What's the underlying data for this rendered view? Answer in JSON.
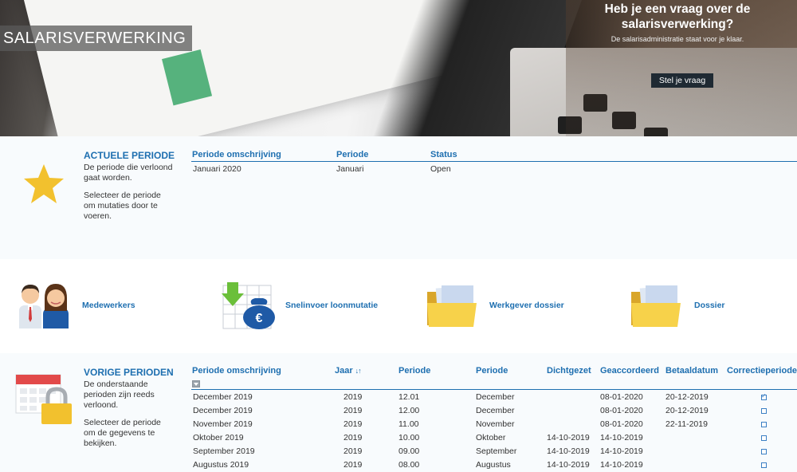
{
  "hero": {
    "title": "SALARISVERWERKING",
    "question": "Heb je een vraag over de salarisverwerking?",
    "subtext": "De salarisadministratie staat voor je klaar.",
    "button_label": "Stel je vraag"
  },
  "current": {
    "title": "ACTUELE PERIODE",
    "desc1": "De periode die verloond gaat worden.",
    "desc2": "Selecteer de periode om mutaties door te voeren.",
    "columns": [
      "Periode omschrijving",
      "Periode",
      "Status"
    ],
    "row": {
      "omschrijving": "Januari 2020",
      "periode": "Januari",
      "status": "Open"
    }
  },
  "tiles": [
    {
      "label": "Medewerkers",
      "icon": "employees-icon"
    },
    {
      "label": "Snelinvoer loonmutatie",
      "icon": "quick-entry-icon"
    },
    {
      "label": "Werkgever dossier",
      "icon": "folder-icon"
    },
    {
      "label": "Dossier",
      "icon": "folder-icon"
    }
  ],
  "previous": {
    "title": "VORIGE PERIODEN",
    "desc1": "De onderstaande perioden zijn reeds verloond.",
    "desc2": "Selecteer de periode om de gegevens te bekijken.",
    "columns": [
      "Periode omschrijving",
      "Jaar",
      "Periode",
      "Periode",
      "Dichtgezet",
      "Geaccordeerd",
      "Betaaldatum",
      "Correctieperiode"
    ],
    "sort_glyph": "↓↑",
    "rows": [
      {
        "omschrijving": "December 2019",
        "jaar": "2019",
        "nr": "12.01",
        "periode": "December",
        "dichtgezet": "",
        "geaccordeerd": "08-01-2020",
        "betaaldatum": "20-12-2019",
        "correctie": true
      },
      {
        "omschrijving": "December 2019",
        "jaar": "2019",
        "nr": "12.00",
        "periode": "December",
        "dichtgezet": "",
        "geaccordeerd": "08-01-2020",
        "betaaldatum": "20-12-2019",
        "correctie": false
      },
      {
        "omschrijving": "November 2019",
        "jaar": "2019",
        "nr": "11.00",
        "periode": "November",
        "dichtgezet": "",
        "geaccordeerd": "08-01-2020",
        "betaaldatum": "22-11-2019",
        "correctie": false
      },
      {
        "omschrijving": "Oktober 2019",
        "jaar": "2019",
        "nr": "10.00",
        "periode": "Oktober",
        "dichtgezet": "14-10-2019",
        "geaccordeerd": "14-10-2019",
        "betaaldatum": "",
        "correctie": false
      },
      {
        "omschrijving": "September 2019",
        "jaar": "2019",
        "nr": "09.00",
        "periode": "September",
        "dichtgezet": "14-10-2019",
        "geaccordeerd": "14-10-2019",
        "betaaldatum": "",
        "correctie": false
      },
      {
        "omschrijving": "Augustus 2019",
        "jaar": "2019",
        "nr": "08.00",
        "periode": "Augustus",
        "dichtgezet": "14-10-2019",
        "geaccordeerd": "14-10-2019",
        "betaaldatum": "",
        "correctie": false
      }
    ]
  },
  "colors": {
    "accent": "#1e6fb0",
    "band": "#f8fbfd",
    "star": "#f2c12e",
    "folder": "#f7d24a"
  }
}
